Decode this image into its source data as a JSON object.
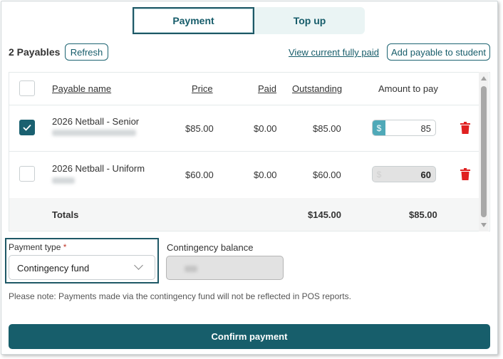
{
  "tabs": [
    {
      "label": "Payment",
      "active": true
    },
    {
      "label": "Top up",
      "active": false
    }
  ],
  "header": {
    "payables_count": "2 Payables",
    "refresh_label": "Refresh",
    "view_link": "View current fully paid",
    "add_payable_label": "Add payable to student"
  },
  "table": {
    "columns": [
      "Payable name",
      "Price",
      "Paid",
      "Outstanding",
      "Amount to pay"
    ],
    "rows": [
      {
        "checked": true,
        "name": "2026 Netball - Senior",
        "price": "$85.00",
        "paid": "$0.00",
        "outstanding": "$85.00",
        "currency": "$",
        "amount": "85",
        "editable": true
      },
      {
        "checked": false,
        "name": "2026 Netball - Uniform",
        "price": "$60.00",
        "paid": "$0.00",
        "outstanding": "$60.00",
        "currency": "$",
        "amount": "60",
        "editable": false
      }
    ],
    "totals": {
      "label": "Totals",
      "outstanding": "$145.00",
      "amount": "$85.00"
    }
  },
  "payment_type": {
    "label": "Payment type",
    "required_mark": "*",
    "value": "Contingency fund"
  },
  "contingency_balance": {
    "label": "Contingency balance"
  },
  "note": "Please note: Payments made via the contingency fund will not be reflected in POS reports.",
  "confirm_label": "Confirm payment",
  "colors": {
    "primary": "#175e6b",
    "accent": "#4fa9b8",
    "danger": "#e02020",
    "tab_inactive_bg": "#eaf4f4"
  },
  "icons": [
    "check-icon",
    "trash-icon",
    "chevron-down-icon"
  ]
}
